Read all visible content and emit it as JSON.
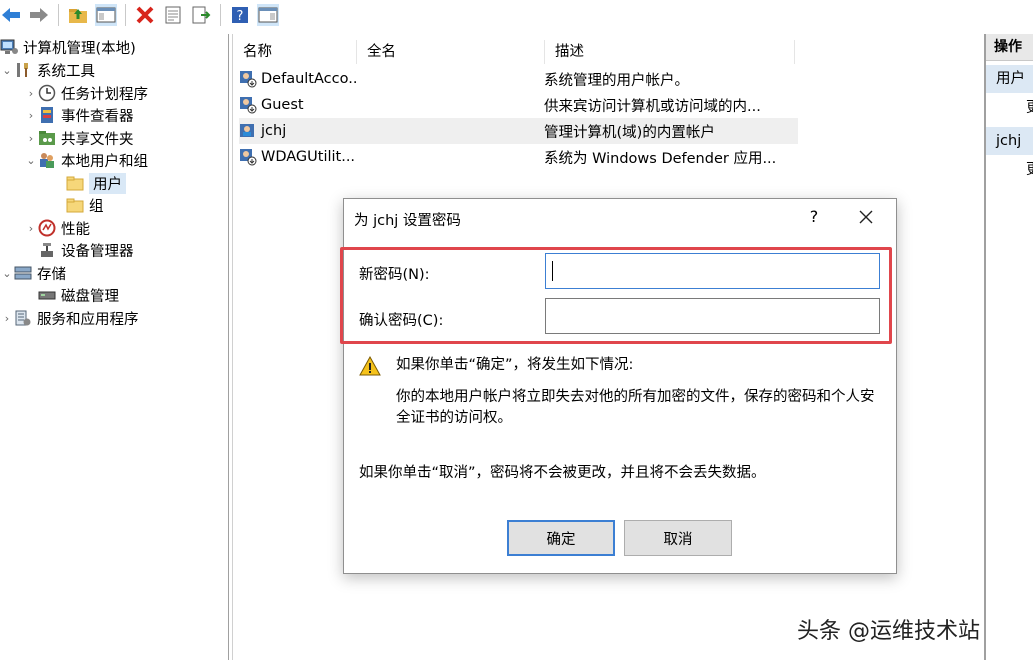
{
  "toolbar": {
    "buttons": [
      "back-icon",
      "forward-icon",
      "up-folder-icon",
      "show-hide-tree-icon",
      "delete-icon",
      "properties-icon",
      "export-icon",
      "help-icon",
      "action-pane-icon"
    ]
  },
  "tree": {
    "root": "计算机管理(本地)",
    "system_tools": "系统工具",
    "task_scheduler": "任务计划程序",
    "event_viewer": "事件查看器",
    "shared_folders": "共享文件夹",
    "local_users_groups": "本地用户和组",
    "users": "用户",
    "groups": "组",
    "performance": "性能",
    "device_manager": "设备管理器",
    "storage": "存储",
    "disk_management": "磁盘管理",
    "services_apps": "服务和应用程序"
  },
  "list": {
    "columns": [
      "名称",
      "全名",
      "描述"
    ],
    "rows": [
      {
        "name": "DefaultAcco...",
        "full": "",
        "desc": "系统管理的用户帐户。"
      },
      {
        "name": "Guest",
        "full": "",
        "desc": "供来宾访问计算机或访问域的内..."
      },
      {
        "name": "jchj",
        "full": "",
        "desc": "管理计算机(域)的内置帐户"
      },
      {
        "name": "WDAGUtilit...",
        "full": "",
        "desc": "系统为 Windows Defender 应用..."
      }
    ]
  },
  "actions": {
    "header": "操作",
    "section1": "用户",
    "item1": "更",
    "section2": "jchj",
    "item2": "更"
  },
  "dialog": {
    "title": "为 jchj 设置密码",
    "help": "?",
    "new_password_label": "新密码(N):",
    "new_password_value": "",
    "confirm_password_label": "确认密码(C):",
    "confirm_password_value": "",
    "warning_heading": "如果你单击“确定”，将发生如下情况:",
    "warning_body": "你的本地用户帐户将立即失去对他的所有加密的文件，保存的密码和个人安全证书的访问权。",
    "cancel_note": "如果你单击“取消”，密码将不会被更改，并且将不会丢失数据。",
    "ok": "确定",
    "cancel": "取消"
  },
  "watermark": "头条 @运维技术站",
  "colors": {
    "highlight_box": "#e0464c",
    "focus": "#3c7fd3",
    "selection": "#d9e8f6"
  }
}
